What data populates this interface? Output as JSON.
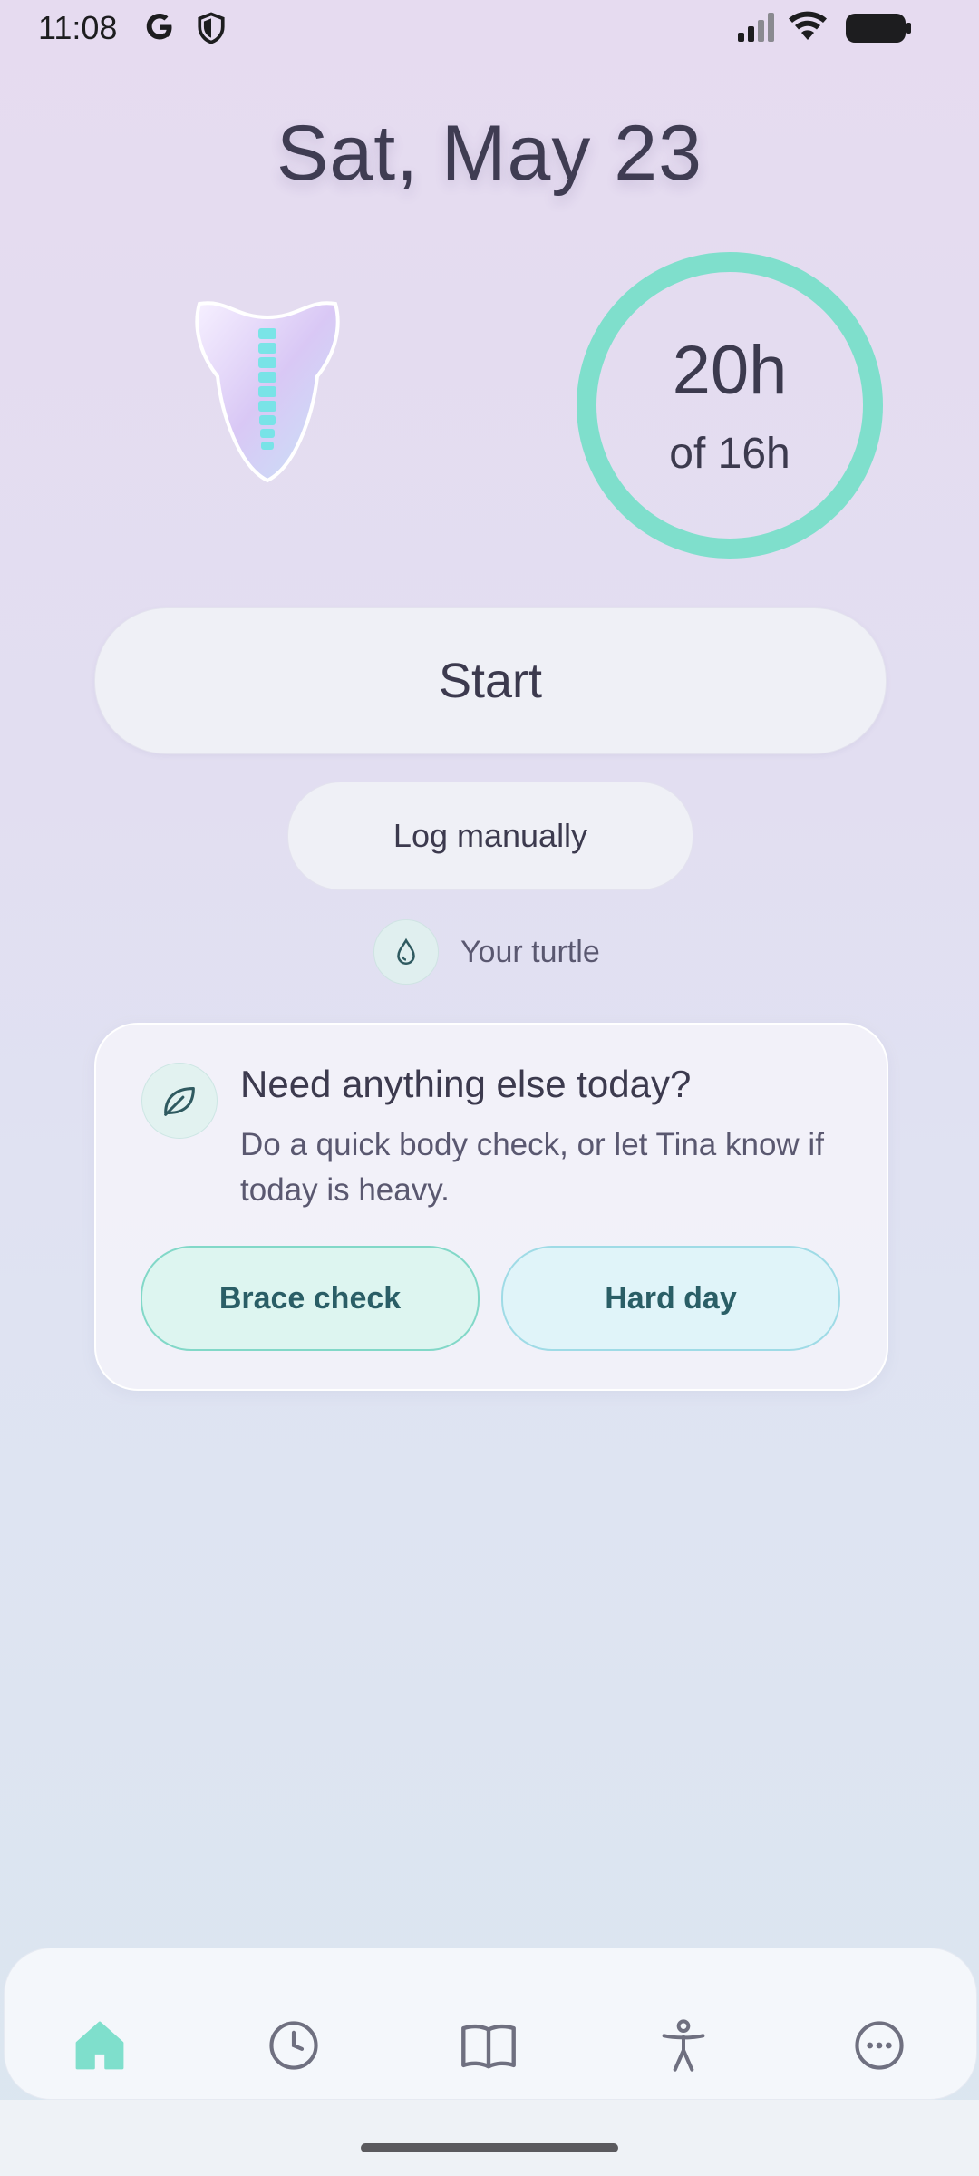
{
  "status_bar": {
    "time": "11:08",
    "icons": [
      "google-g-icon",
      "shield-icon",
      "signal-icon",
      "wifi-icon",
      "battery-icon"
    ]
  },
  "header": {
    "date": "Sat, May 23"
  },
  "progress": {
    "hours": "20h",
    "goal": "of 16h",
    "ring_color": "#7fdfcc"
  },
  "actions": {
    "start_label": "Start",
    "log_label": "Log manually"
  },
  "turtle": {
    "label": "Your turtle",
    "icon": "water-drop-icon"
  },
  "card": {
    "icon": "leaf-icon",
    "title": "Need anything else today?",
    "body": "Do a quick body check, or let Tina know if today is heavy.",
    "brace_check_label": "Brace check",
    "hard_day_label": "Hard day"
  },
  "nav": {
    "items": [
      {
        "name": "home",
        "icon": "home-icon",
        "active": true
      },
      {
        "name": "history",
        "icon": "clock-icon",
        "active": false
      },
      {
        "name": "learn",
        "icon": "book-icon",
        "active": false
      },
      {
        "name": "exercises",
        "icon": "body-icon",
        "active": false
      },
      {
        "name": "more",
        "icon": "more-icon",
        "active": false
      }
    ],
    "active_color": "#7fdfcc",
    "inactive_color": "#6f7080"
  }
}
